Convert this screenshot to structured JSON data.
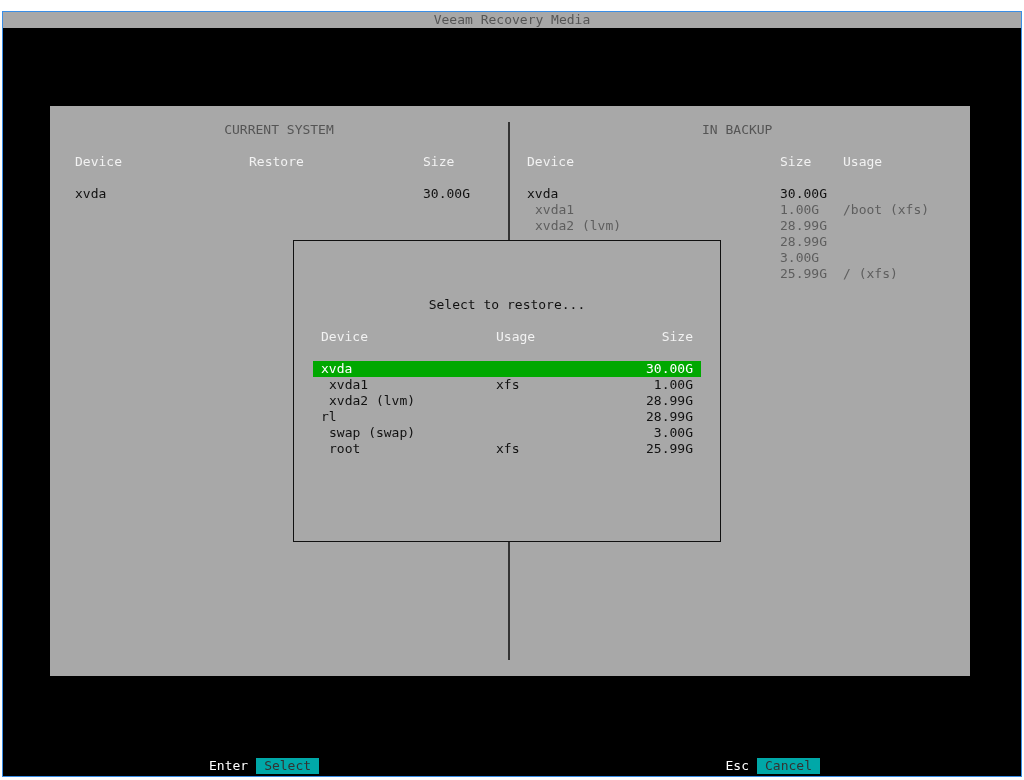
{
  "window": {
    "title": "Veeam Recovery Media"
  },
  "current_system": {
    "title": "CURRENT SYSTEM",
    "columns": [
      "Device",
      "Restore",
      "Size"
    ],
    "rows": [
      {
        "device": "xvda",
        "size": "30.00G"
      }
    ]
  },
  "in_backup": {
    "title": "IN BACKUP",
    "columns": [
      "Device",
      "Size",
      "Usage"
    ],
    "rows": [
      {
        "device": "xvda",
        "size": "30.00G",
        "dimmed": false,
        "children": [
          {
            "device": "xvda1",
            "size": "1.00G",
            "usage": "/boot (xfs)",
            "dimmed": true
          },
          {
            "device": "xvda2 (lvm)",
            "size": "28.99G",
            "dimmed": true
          }
        ]
      },
      {
        "size": "28.99G",
        "dimmed": true,
        "children": [
          {
            "size": "3.00G",
            "dimmed": true
          },
          {
            "size": "25.99G",
            "usage": "/ (xfs)",
            "dimmed": true
          }
        ]
      }
    ]
  },
  "dialog": {
    "title": "Select to restore...",
    "columns": [
      "Device",
      "Usage",
      "Size"
    ],
    "items": [
      {
        "device": "xvda",
        "size": "30.00G",
        "selected": true,
        "children": [
          {
            "device": "xvda1",
            "usage": "xfs",
            "size": "1.00G",
            "selected": false
          },
          {
            "device": "xvda2 (lvm)",
            "size": "28.99G",
            "selected": false
          }
        ]
      },
      {
        "device": "rl",
        "size": "28.99G",
        "selected": false,
        "children": [
          {
            "device": "swap (swap)",
            "size": "3.00G",
            "selected": false
          },
          {
            "device": "root",
            "usage": "xfs",
            "size": "25.99G",
            "selected": false
          }
        ]
      }
    ]
  },
  "hotkeys": [
    {
      "key": "Enter",
      "action": "Select"
    },
    {
      "key": "Esc",
      "action": "Cancel"
    }
  ]
}
